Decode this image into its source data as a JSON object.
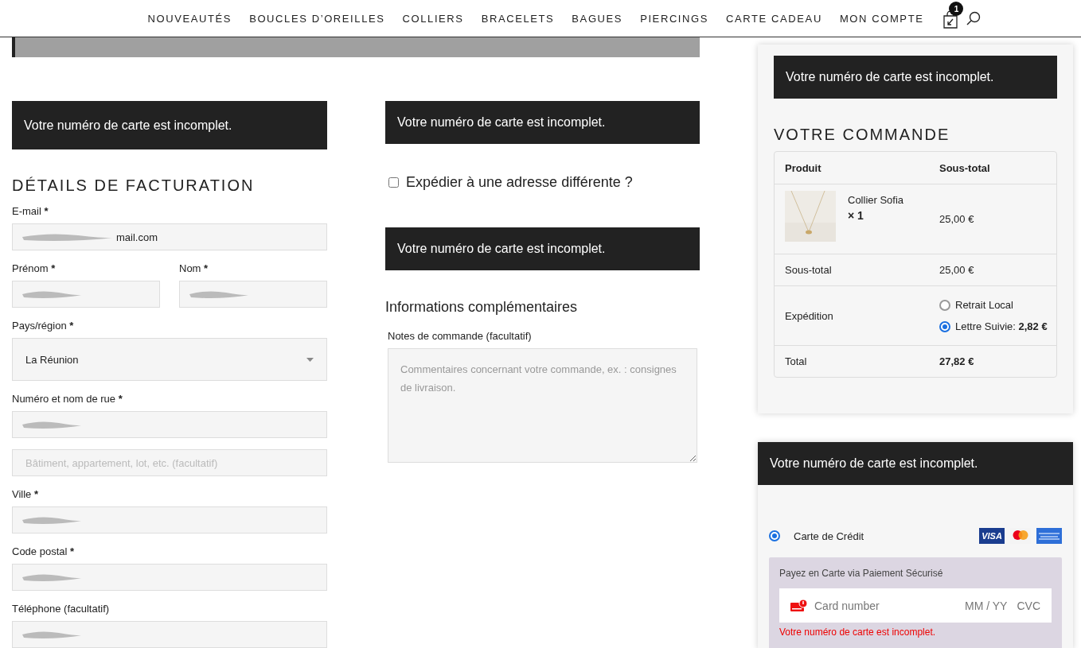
{
  "nav": {
    "items": [
      "NOUVEAUTÉS",
      "BOUCLES D’OREILLES",
      "COLLIERS",
      "BRACELETS",
      "BAGUES",
      "PIERCINGS",
      "CARTE CADEAU",
      "MON COMPTE"
    ],
    "cart_count": "1"
  },
  "billing": {
    "alert": "Votre numéro de carte est incomplet.",
    "title": "DÉTAILS DE FACTURATION",
    "rows": [
      {
        "fields": [
          {
            "kind": "input",
            "label": "E-mail",
            "mark": "*",
            "value": "mail.com",
            "redacted": true
          }
        ]
      },
      {
        "fields": [
          {
            "kind": "input",
            "label": "Prénom",
            "mark": "*",
            "redacted": true
          },
          {
            "kind": "input",
            "label": "Nom",
            "mark": "*",
            "redacted": true
          }
        ]
      },
      {
        "fields": [
          {
            "kind": "select",
            "label": "Pays/région",
            "mark": "*",
            "value": "La Réunion"
          }
        ]
      },
      {
        "fields": [
          {
            "kind": "input",
            "label": "Numéro et nom de rue",
            "mark": "*",
            "redacted": true
          }
        ]
      },
      {
        "fields": [
          {
            "kind": "placeholder",
            "placeholder": "Bâtiment, appartement, lot, etc. (facultatif)"
          }
        ]
      },
      {
        "fields": [
          {
            "kind": "input",
            "label": "Ville",
            "mark": "*",
            "redacted": true
          }
        ]
      },
      {
        "fields": [
          {
            "kind": "input",
            "label": "Code postal",
            "mark": "*",
            "redacted": true
          }
        ]
      },
      {
        "fields": [
          {
            "kind": "input",
            "label": "Téléphone (facultatif)",
            "redacted": true
          }
        ]
      }
    ]
  },
  "shipping": {
    "alert": "Votre numéro de carte est incomplet.",
    "checkbox": {
      "label": "Expédier à une adresse différente ?",
      "checked": false
    },
    "alert_2": "Votre numéro de carte est incomplet.",
    "title": "Informations complémentaires",
    "notes": {
      "label": "Notes de commande (facultatif)",
      "placeholder": "Commentaires concernant votre commande, ex. : consignes de livraison."
    }
  },
  "order": {
    "alert": "Votre numéro de carte est incomplet.",
    "title": "VOTRE COMMANDE",
    "columns": [
      "Produit",
      "Sous-total"
    ],
    "product": {
      "name": "Collier Sofia",
      "qty": "× 1",
      "price": "25,00 €"
    },
    "subtotal": {
      "label": "Sous-total",
      "value": "25,00 €"
    },
    "shipping": {
      "label": "Expédition",
      "options": [
        {
          "label": "Retrait Local",
          "selected": false
        },
        {
          "label": "Lettre Suivie: **2,82 €**",
          "selected": true
        }
      ]
    },
    "total": {
      "label": "Total",
      "value": "27,82 €"
    }
  },
  "payment": {
    "alert": "Votre numéro de carte est incomplet.",
    "methods": [
      {
        "label": "Carte de Crédit",
        "selected": true
      }
    ],
    "visa": "VISA",
    "box": {
      "title": "Payez en Carte via Paiement Sécurisé",
      "card_placeholder": "Card number",
      "expiry_placeholder": "MM / YY",
      "cvc_placeholder": "CVC",
      "error": "Votre numéro de carte est incomplet."
    }
  }
}
